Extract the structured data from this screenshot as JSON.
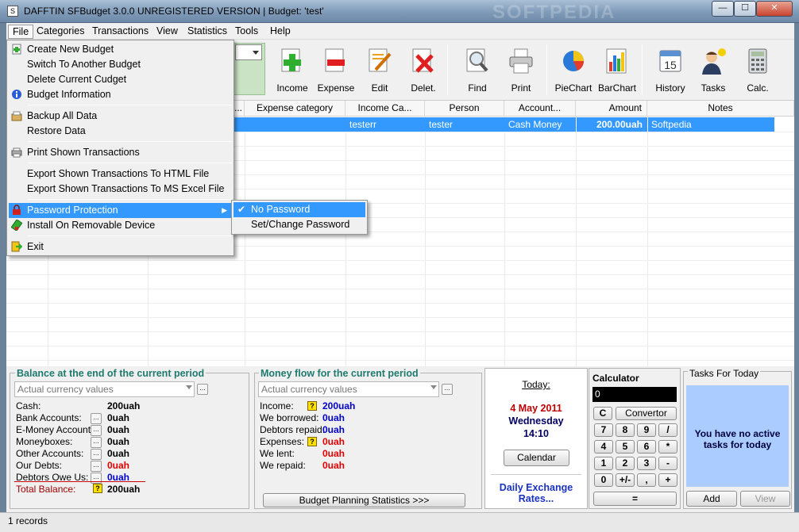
{
  "window": {
    "title": "DAFFTIN SFBudget   3.0.0    UNREGISTERED VERSION |  Budget: 'test'",
    "min": "—",
    "max": "☐",
    "close": "✕"
  },
  "menubar": [
    "File",
    "Categories",
    "Transactions",
    "View",
    "Statistics",
    "Tools",
    "Help"
  ],
  "toolbar": [
    "Income",
    "Expense",
    "Edit",
    "Delet.",
    "Find",
    "Print",
    "PieChart",
    "BarChart",
    "History",
    "Tasks",
    "Calc."
  ],
  "grid": {
    "headers": [
      "...",
      "Expense category",
      "Income Ca...",
      "Person",
      "Account...",
      "Amount",
      "Notes"
    ],
    "row": {
      "income_cat": "testerr",
      "person": "tester",
      "account": "Cash Money",
      "amount": "200.00uah",
      "notes": "Softpedia"
    }
  },
  "file_menu": {
    "items": [
      "Create New Budget",
      "Switch To Another Budget",
      "Delete Current Cudget",
      "Budget Information",
      "Backup All Data",
      "Restore Data",
      "Print Shown Transactions",
      "Export Shown Transactions To HTML File",
      "Export Shown Transactions To MS Excel File",
      "Password Protection",
      "Install On Removable Device",
      "Exit"
    ],
    "submenu": [
      "No Password",
      "Set/Change Password"
    ]
  },
  "balance": {
    "title": "Balance at the end of the current period",
    "combo": "Actual currency values",
    "rows": [
      {
        "label": "Cash:",
        "value": "200uah",
        "color": "#000000"
      },
      {
        "label": "Bank Accounts:",
        "value": "0uah",
        "color": "#000000"
      },
      {
        "label": "E-Money Accounts:",
        "value": "0uah",
        "color": "#000000"
      },
      {
        "label": "Moneyboxes:",
        "value": "0uah",
        "color": "#000000"
      },
      {
        "label": "Other Accounts:",
        "value": "0uah",
        "color": "#000000"
      },
      {
        "label": "Our Debts:",
        "value": "0uah",
        "color": "#e00000"
      },
      {
        "label": "Debtors Owe Us:",
        "value": "0uah",
        "color": "#0000cc"
      }
    ],
    "total_label": "Total Balance:",
    "total_value": "200uah"
  },
  "moneyflow": {
    "title": "Money flow for the current period",
    "combo": "Actual currency values",
    "rows": [
      {
        "label": "Income:",
        "value": "200uah",
        "color": "#0000cc"
      },
      {
        "label": "We borrowed:",
        "value": "0uah",
        "color": "#0000cc"
      },
      {
        "label": "Debtors repaid:",
        "value": "0uah",
        "color": "#0000cc"
      },
      {
        "label": "Expenses:",
        "value": "0uah",
        "color": "#e00000"
      },
      {
        "label": "We lent:",
        "value": "0uah",
        "color": "#e00000"
      },
      {
        "label": "We repaid:",
        "value": "0uah",
        "color": "#e00000"
      }
    ],
    "button": "Budget Planning Statistics >>>"
  },
  "today": {
    "label": "Today:",
    "date": "4 May 2011",
    "weekday": "Wednesday",
    "time": "14:10",
    "calendar_btn": "Calendar",
    "exchange": "Daily Exchange Rates..."
  },
  "calculator": {
    "title": "Calculator",
    "display": "0",
    "clear": "C",
    "convertor": "Convertor",
    "keys": [
      [
        "7",
        "8",
        "9",
        "/"
      ],
      [
        "4",
        "5",
        "6",
        "*"
      ],
      [
        "1",
        "2",
        "3",
        "-"
      ],
      [
        "0",
        "+/-",
        ",",
        "+"
      ]
    ],
    "equals": "="
  },
  "tasks": {
    "title": "Tasks For Today",
    "message": "You have no active tasks for today",
    "add": "Add",
    "view": "View"
  },
  "status": {
    "records": "1 records"
  },
  "watermark": "SOFTPEDIA"
}
